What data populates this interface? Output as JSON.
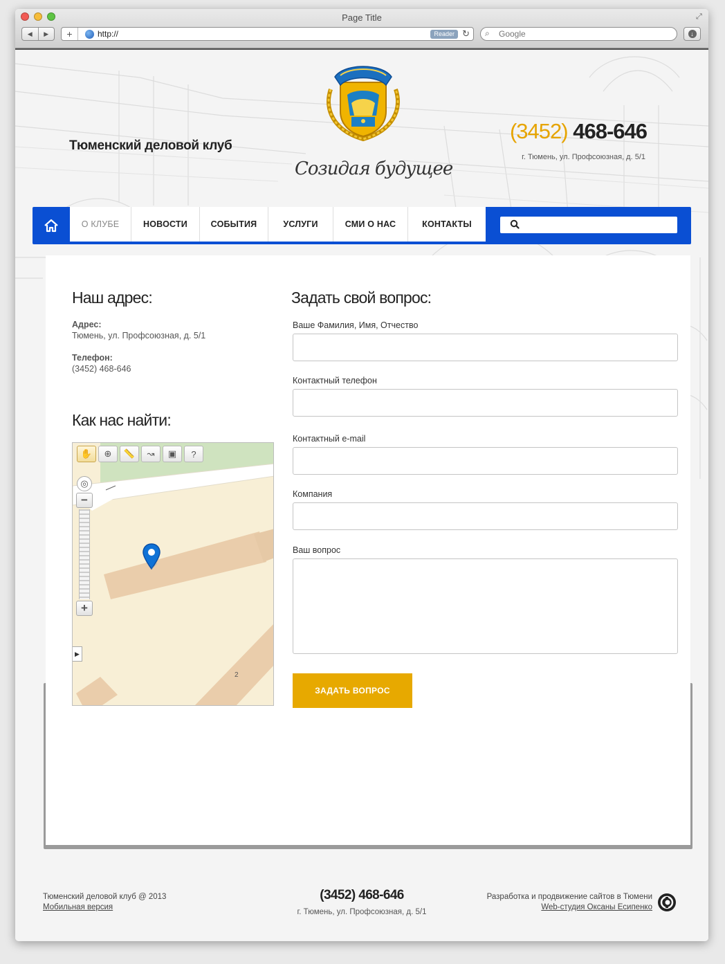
{
  "browser": {
    "window_title": "Page Title",
    "url": "http://",
    "reader_label": "Reader",
    "search_placeholder": "Google"
  },
  "header": {
    "brand": "Тюменский деловой клуб",
    "motto": "Созидая будущее",
    "phone_code": "(3452)",
    "phone_number": "468-646",
    "address": "г. Тюмень, ул. Профсоюзная, д. 5/1"
  },
  "nav": {
    "items": [
      {
        "label": "О КЛУБЕ",
        "active": true
      },
      {
        "label": "НОВОСТИ",
        "active": false
      },
      {
        "label": "СОБЫТИЯ",
        "active": false
      },
      {
        "label": "УСЛУГИ",
        "active": false
      },
      {
        "label": "СМИ О НАС",
        "active": false
      },
      {
        "label": "КОНТАКТЫ",
        "active": false
      }
    ],
    "search_placeholder": ""
  },
  "contacts": {
    "address_heading": "Наш адрес:",
    "address_label": "Адрес:",
    "address_value": "Тюмень, ул. Профсоюзная, д.  5/1",
    "phone_label": "Телефон:",
    "phone_value": "(3452) 468-646",
    "map_heading": "Как нас найти:",
    "map_house_number": "2"
  },
  "form": {
    "heading": "Задать свой вопрос:",
    "name_label": "Ваше Фамилия, Имя, Отчество",
    "phone_label": "Контактный телефон",
    "email_label": "Контактный e-mail",
    "company_label": "Компания",
    "question_label": "Ваш вопрос",
    "submit_label": "ЗАДАТЬ ВОПРОС"
  },
  "footer": {
    "copyright": "Тюменский деловой клуб @ 2013",
    "mobile_link": "Мобильная версия",
    "phone": "(3452) 468-646",
    "address": "г. Тюмень, ул. Профсоюзная, д. 5/1",
    "developer_text": "Разработка и продвижение сайтов в Тюмени",
    "developer_link": "Web-студия Оксаны Есипенко"
  },
  "colors": {
    "accent_blue": "#0a4fd3",
    "accent_gold": "#e7a900"
  }
}
